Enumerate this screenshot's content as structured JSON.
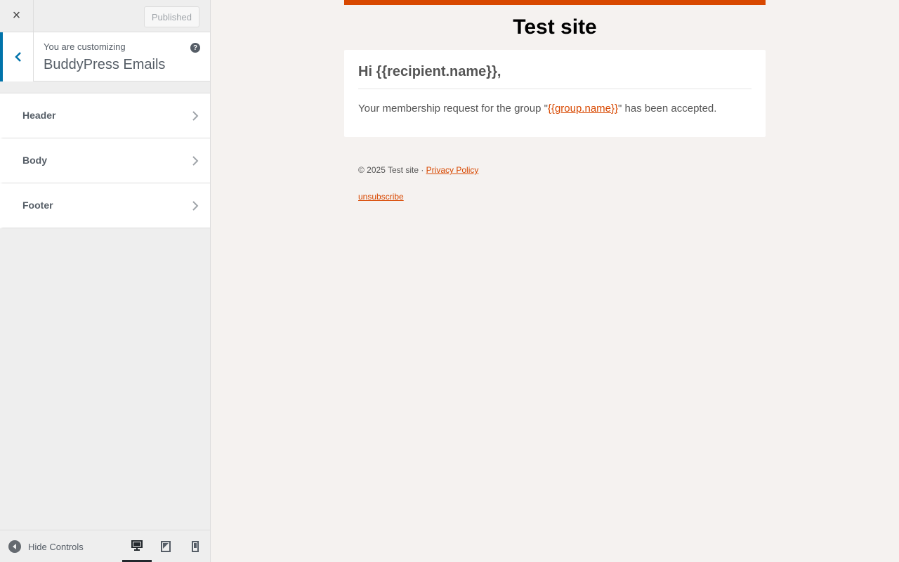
{
  "topbar": {
    "close_icon": "×",
    "published_label": "Published"
  },
  "info": {
    "customizing_label": "You are customizing",
    "title": "BuddyPress Emails",
    "help_icon": "?"
  },
  "sections": [
    {
      "label": "Header"
    },
    {
      "label": "Body"
    },
    {
      "label": "Footer"
    }
  ],
  "footer_bar": {
    "hide_controls_label": "Hide Controls",
    "devices": [
      "desktop",
      "tablet",
      "mobile"
    ],
    "active_device": "desktop"
  },
  "email": {
    "accent_color": "#d84800",
    "site_title": "Test site",
    "greeting": "Hi {{recipient.name}},",
    "message_before": "Your membership request for the group \"",
    "group_link": "{{group.name}}",
    "message_after": "\" has been accepted.",
    "copyright": "© 2025 Test site · ",
    "privacy_link": "Privacy Policy",
    "unsubscribe_link": "unsubscribe"
  }
}
